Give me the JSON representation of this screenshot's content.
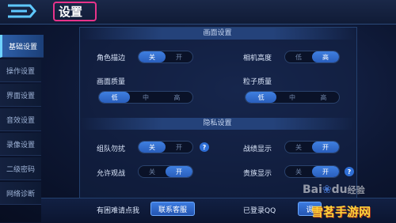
{
  "header": {
    "title": "设置"
  },
  "sidebar": {
    "items": [
      {
        "label": "基础设置",
        "active": true
      },
      {
        "label": "操作设置",
        "active": false
      },
      {
        "label": "界面设置",
        "active": false
      },
      {
        "label": "音效设置",
        "active": false
      },
      {
        "label": "录像设置",
        "active": false
      },
      {
        "label": "二级密码",
        "active": false
      },
      {
        "label": "网络诊断",
        "active": false
      }
    ]
  },
  "sections": {
    "display": "画面设置",
    "privacy": "隐私设置"
  },
  "settings": {
    "outline": {
      "label": "角色描边",
      "options": [
        "关",
        "开"
      ],
      "selected": "关"
    },
    "camera_height": {
      "label": "相机高度",
      "options": [
        "低",
        "高"
      ],
      "selected": "高"
    },
    "quality": {
      "label": "画面质量",
      "options": [
        "低",
        "中",
        "高"
      ],
      "selected": "低"
    },
    "particle": {
      "label": "粒子质量",
      "options": [
        "低",
        "中",
        "高"
      ],
      "selected": "低"
    },
    "no_disturb": {
      "label": "组队勿扰",
      "options": [
        "关",
        "开"
      ],
      "selected": "关"
    },
    "record_show": {
      "label": "战绩显示",
      "options": [
        "关",
        "开"
      ],
      "selected": "开"
    },
    "allow_watch": {
      "label": "允许观战",
      "options": [
        "关",
        "开"
      ],
      "selected": "开"
    },
    "noble_show": {
      "label": "贵族显示",
      "options": [
        "关",
        "开"
      ],
      "selected": "开"
    }
  },
  "bottom": {
    "help_text": "有困难请点我",
    "service_button": "联系客服",
    "login_text": "已登录QQ",
    "partial_button": "调"
  },
  "watermark": {
    "baidu": "Bai",
    "du": "du",
    "jingyan": "经验",
    "site": "雪茗手游网"
  },
  "colors": {
    "accent": "#3f7fe0",
    "highlight_border": "#e8338a"
  }
}
